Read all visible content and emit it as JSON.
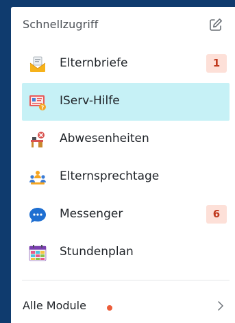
{
  "header": {
    "title": "Schnellzugriff"
  },
  "items": [
    {
      "label": "Elternbriefe",
      "icon": "envelope-letter-icon",
      "badge": "1"
    },
    {
      "label": "IServ-Hilfe",
      "icon": "help-monitor-icon",
      "badge": null,
      "active": true
    },
    {
      "label": "Abwesenheiten",
      "icon": "absence-desk-icon",
      "badge": null
    },
    {
      "label": "Elternsprechtage",
      "icon": "meeting-people-icon",
      "badge": null
    },
    {
      "label": "Messenger",
      "icon": "chat-bubble-icon",
      "badge": "6"
    },
    {
      "label": "Stundenplan",
      "icon": "timetable-calendar-icon",
      "badge": null
    }
  ],
  "footer": {
    "label": "Alle Module"
  },
  "colors": {
    "background": "#0f3b6e",
    "active_bg": "#c6f1f6",
    "badge_bg": "#fde0d8",
    "badge_text": "#c0391e",
    "dot": "#ec5d3a"
  }
}
